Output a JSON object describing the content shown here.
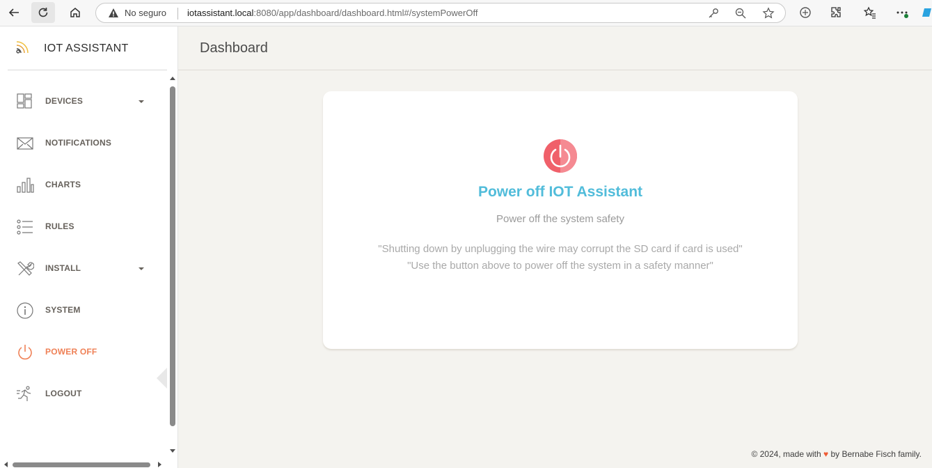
{
  "browser": {
    "security_label": "No seguro",
    "url_host": "iotassistant.local",
    "url_rest": ":8080/app/dashboard/dashboard.html#/systemPowerOff"
  },
  "sidebar": {
    "app_name": "IOT ASSISTANT",
    "items": [
      {
        "label": "DEVICES",
        "icon": "devices-grid-icon",
        "has_caret": true
      },
      {
        "label": "NOTIFICATIONS",
        "icon": "envelope-icon",
        "has_caret": false
      },
      {
        "label": "CHARTS",
        "icon": "bar-chart-icon",
        "has_caret": false
      },
      {
        "label": "RULES",
        "icon": "list-icon",
        "has_caret": false
      },
      {
        "label": "INSTALL",
        "icon": "tools-icon",
        "has_caret": true
      },
      {
        "label": "SYSTEM",
        "icon": "info-icon",
        "has_caret": false
      },
      {
        "label": "POWER OFF",
        "icon": "power-icon",
        "has_caret": false,
        "active": true
      },
      {
        "label": "LOGOUT",
        "icon": "running-man-icon",
        "has_caret": false
      }
    ]
  },
  "header": {
    "title": "Dashboard"
  },
  "card": {
    "title": "Power off IOT Assistant",
    "subtitle": "Power off the system safety",
    "warning_line1": "\"Shutting down by unplugging the wire may corrupt the SD card if card is used\"",
    "warning_line2": "\"Use the button above to power off the system in a safety manner\""
  },
  "footer": {
    "prefix": "© 2024, made with",
    "heart": "♥",
    "suffix": "by Bernabe Fisch family."
  },
  "colors": {
    "accent_active": "#ef8157",
    "title_blue": "#51bcda",
    "power_red": "#f0606a",
    "page_bg": "#f4f3ef"
  }
}
